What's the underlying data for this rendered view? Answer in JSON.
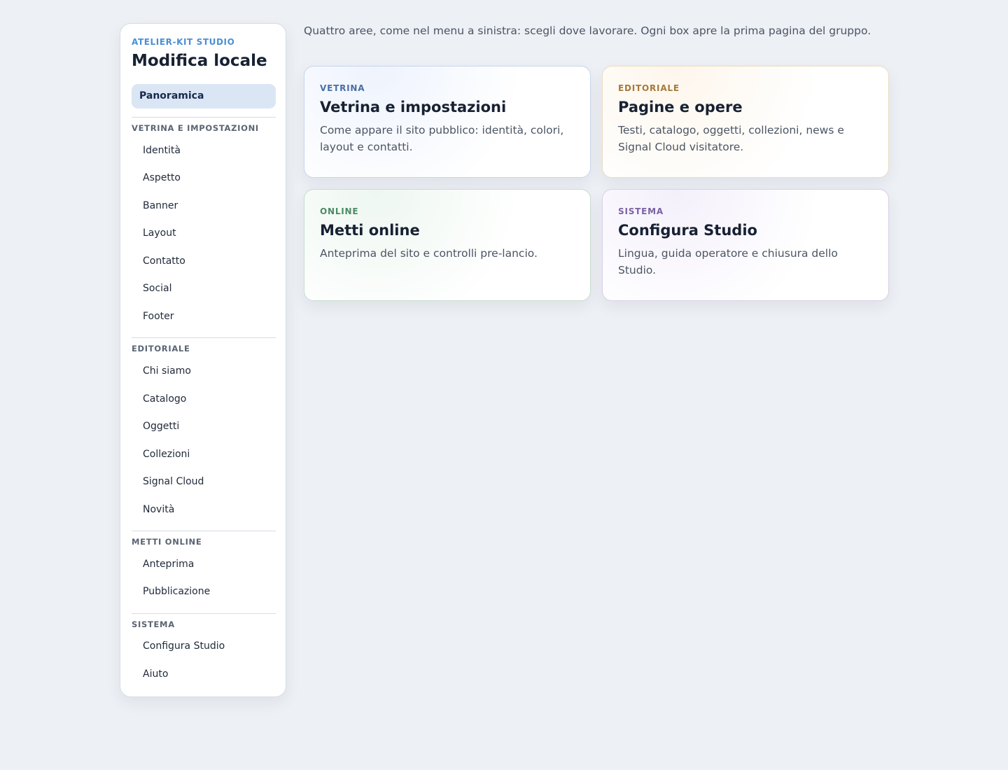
{
  "sidebar": {
    "brand": "ATELIER-KIT STUDIO",
    "title": "Modifica locale",
    "active_item": "Panoramica",
    "groups": [
      {
        "label": "VETRINA E IMPOSTAZIONI",
        "items": [
          "Identità",
          "Aspetto",
          "Banner",
          "Layout",
          "Contatto",
          "Social",
          "Footer"
        ]
      },
      {
        "label": "EDITORIALE",
        "items": [
          "Chi siamo",
          "Catalogo",
          "Oggetti",
          "Collezioni",
          "Signal Cloud",
          "Novità"
        ]
      },
      {
        "label": "METTI ONLINE",
        "items": [
          "Anteprima",
          "Pubblicazione"
        ]
      },
      {
        "label": "SISTEMA",
        "items": [
          "Configura Studio",
          "Aiuto"
        ]
      }
    ]
  },
  "main": {
    "intro": "Quattro aree, come nel menu a sinistra: scegli dove lavorare. Ogni box apre la prima pagina del gruppo.",
    "cards": [
      {
        "tag": "VETRINA",
        "title": "Vetrina e impostazioni",
        "description": "Come appare il sito pubblico: identità, colori, layout e contatti.",
        "accent": "#4a6fa5"
      },
      {
        "tag": "EDITORIALE",
        "title": "Pagine e opere",
        "description": "Testi, catalogo, oggetti, collezioni, news e Signal Cloud visitatore.",
        "accent": "#a57a3c"
      },
      {
        "tag": "ONLINE",
        "title": "Metti online",
        "description": "Anteprima del sito e controlli pre-lancio.",
        "accent": "#4a8a64"
      },
      {
        "tag": "SISTEMA",
        "title": "Configura Studio",
        "description": "Lingua, guida operatore e chiusura dello Studio.",
        "accent": "#7a62a3"
      }
    ]
  }
}
